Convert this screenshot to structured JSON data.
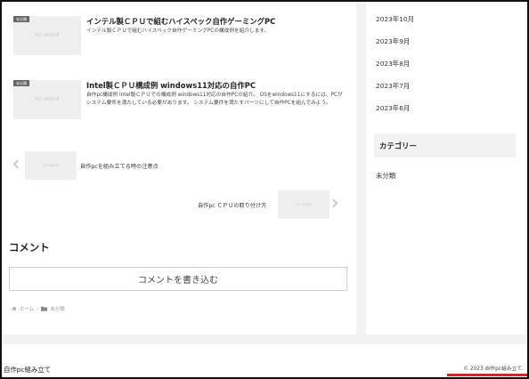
{
  "posts": [
    {
      "badge": "未分類",
      "thumb": "NO IMAGE",
      "title": "インテル製ＣＰＵで組むハイスペック自作ゲーミングPC",
      "desc": "インテル製ＣＰＵで組むハイスペック自作ゲーミングPCの構成例を紹介します。"
    },
    {
      "badge": "未分類",
      "thumb": "NO IMAGE",
      "title": "Intel製ＣＰＵ構成例 windows11対応の自作PC",
      "desc": "自作pc構成例 Intel製ＣＰＵでの構成例 windows11対応の自作PCの紹介。 OSをwindows11にするには、PCがシステム要件を満たしている必要があります。 システム要件を満たすパーツにして自作PCを組んでみよう。"
    }
  ],
  "pager": {
    "prev_thumb": "NO IMAGE",
    "prev_title": "自作pcを組み立てる時の注意点",
    "next_thumb": "NO IMAGE",
    "next_title": "自作pc ＣＰＵの取り付け方"
  },
  "comments": {
    "heading": "コメント",
    "button_label": "コメントを書き込む"
  },
  "breadcrumb": {
    "home": "ホーム",
    "separator": "›",
    "category": "未分類"
  },
  "sidebar": {
    "archives": [
      "2023年10月",
      "2023年9月",
      "2023年8月",
      "2023年7月",
      "2023年6月"
    ],
    "category_heading": "カテゴリー",
    "categories": [
      "未分類"
    ]
  },
  "footer": {
    "site_name": "自作pc組み立て",
    "copyright": "© 2023 自作pc組み立て."
  },
  "colors": {
    "accent_line": "#e02020",
    "page_bg": "#f2f2f2"
  },
  "icons": {
    "home": "home-icon",
    "folder": "folder-icon",
    "prev": "chevron-left-icon",
    "next": "chevron-right-icon"
  }
}
